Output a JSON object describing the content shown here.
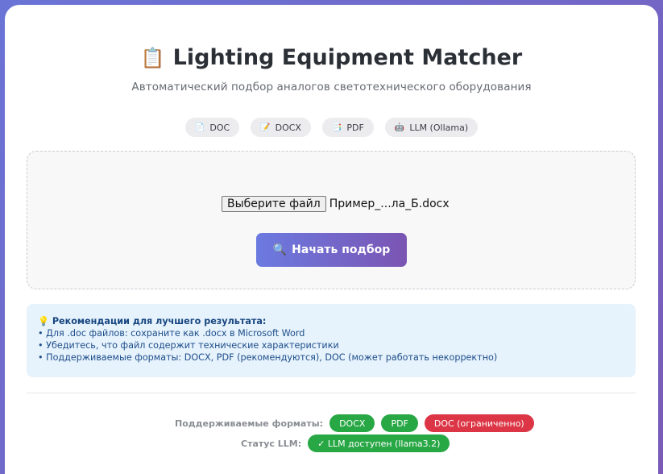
{
  "header": {
    "title_icon": "📋",
    "title": "Lighting Equipment Matcher",
    "subtitle": "Автоматический подбор аналогов светотехнического оборудования"
  },
  "formats": [
    {
      "icon": "📄",
      "label": "DOC"
    },
    {
      "icon": "📝",
      "label": "DOCX"
    },
    {
      "icon": "📑",
      "label": "PDF"
    },
    {
      "icon": "🤖",
      "label": "LLM (Ollama)"
    }
  ],
  "upload": {
    "choose_label": "Выберите файл",
    "file_name": "Пример_...ла_Б.docx",
    "start_icon": "🔍",
    "start_label": "Начать подбор"
  },
  "tips": {
    "icon": "💡",
    "title": "Рекомендации для лучшего результата:",
    "items": [
      "• Для .doc файлов: сохраните как .docx в Microsoft Word",
      "• Убедитесь, что файл содержит технические характеристики",
      "• Поддерживаемые форматы: DOCX, PDF (рекомендуются), DOC (может работать некорректно)"
    ]
  },
  "footer": {
    "formats_label": "Поддерживаемые форматы:",
    "formats": [
      {
        "label": "DOCX",
        "color": "#28a745"
      },
      {
        "label": "PDF",
        "color": "#28a745"
      },
      {
        "label": "DOC (ограниченно)",
        "color": "#dc3545"
      }
    ],
    "llm_label": "Статус LLM:",
    "llm_status": "✓ LLM доступен (llama3.2)",
    "llm_color": "#28a745"
  }
}
